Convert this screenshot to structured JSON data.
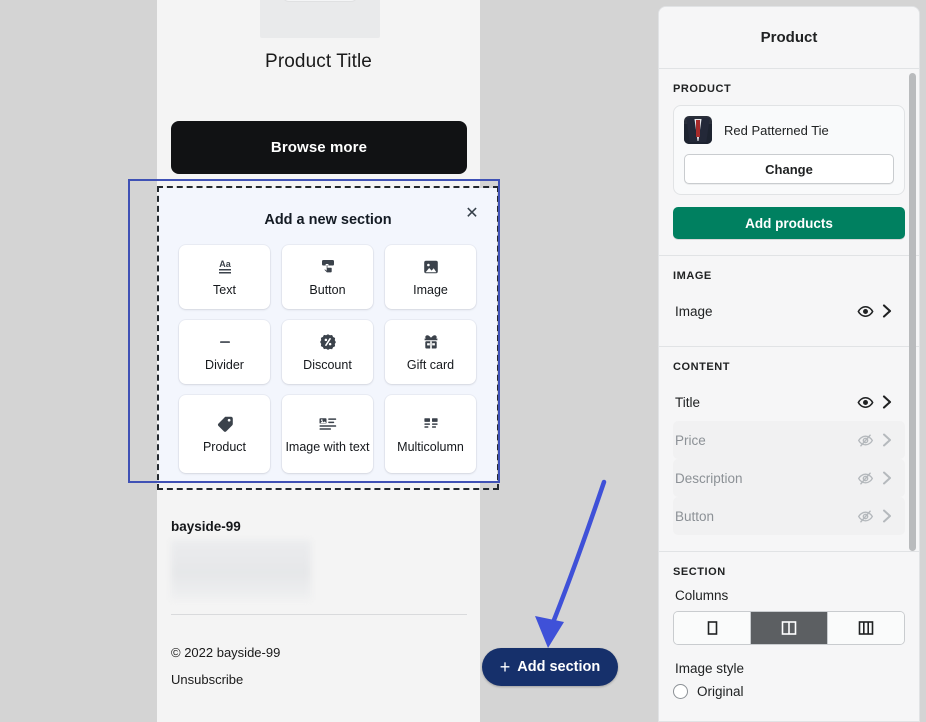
{
  "email_preview": {
    "product_title": "Product Title",
    "browse_button": "Browse more",
    "brand_name": "bayside-99",
    "copyright": "© 2022 bayside-99",
    "unsubscribe": "Unsubscribe"
  },
  "add_section_popover": {
    "title": "Add a new section",
    "close_label": "✕",
    "tiles": [
      {
        "label": "Text",
        "icon": "text-aa-icon"
      },
      {
        "label": "Button",
        "icon": "button-click-icon"
      },
      {
        "label": "Image",
        "icon": "image-icon"
      },
      {
        "label": "Divider",
        "icon": "divider-icon"
      },
      {
        "label": "Discount",
        "icon": "discount-badge-icon"
      },
      {
        "label": "Gift card",
        "icon": "gift-card-icon"
      },
      {
        "label": "Product",
        "icon": "product-tag-icon"
      },
      {
        "label": "Image with text",
        "icon": "image-with-text-icon"
      },
      {
        "label": "Multicolumn",
        "icon": "multicolumn-icon"
      }
    ]
  },
  "add_section_button": {
    "label": "Add section",
    "plus": "+",
    "color": "#16306b"
  },
  "annotation": {
    "arrow_color": "#3f51d8"
  },
  "inspector": {
    "title": "Product",
    "product_group": {
      "label": "PRODUCT",
      "product_name": "Red Patterned Tie",
      "change_button": "Change",
      "add_products_button": "Add products",
      "add_products_color": "#008060"
    },
    "image_group": {
      "label": "IMAGE",
      "rows": [
        {
          "name": "Image",
          "visible": true
        }
      ]
    },
    "content_group": {
      "label": "CONTENT",
      "rows": [
        {
          "name": "Title",
          "visible": true
        },
        {
          "name": "Price",
          "visible": false
        },
        {
          "name": "Description",
          "visible": false
        },
        {
          "name": "Button",
          "visible": false
        }
      ]
    },
    "section_group": {
      "label": "SECTION",
      "columns_label": "Columns",
      "columns_options": [
        "1",
        "2",
        "3"
      ],
      "columns_selected": "2",
      "image_style_label": "Image style",
      "image_style_option": "Original"
    }
  }
}
